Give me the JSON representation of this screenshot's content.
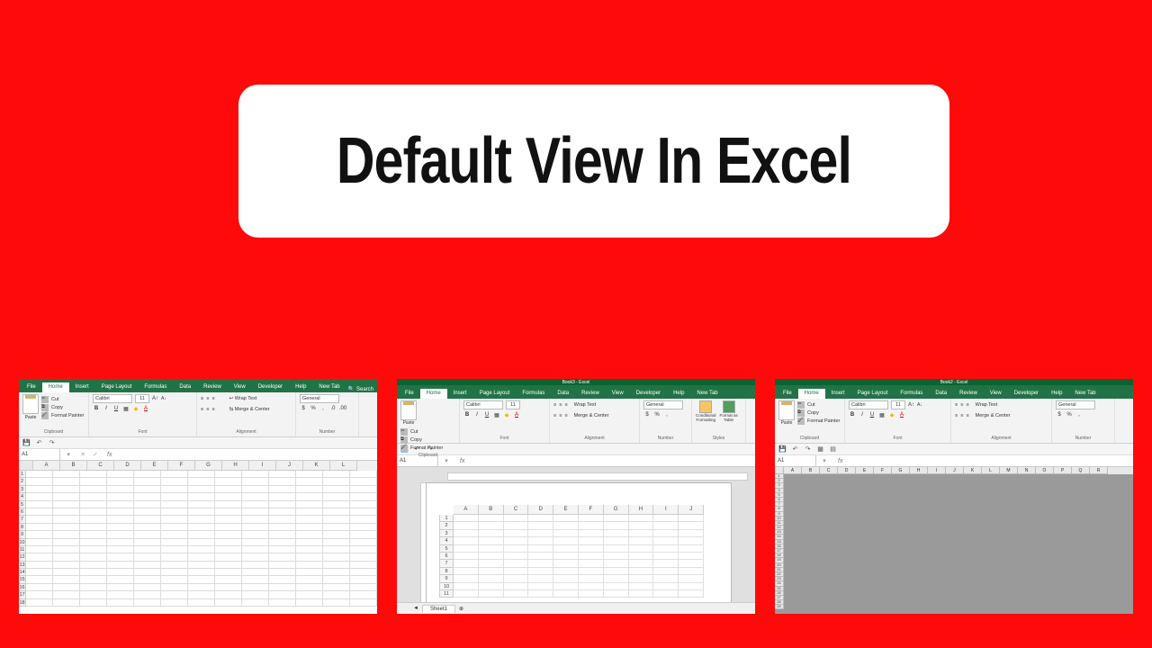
{
  "title": "Default View In Excel",
  "tabs": [
    "File",
    "Home",
    "Insert",
    "Page Layout",
    "Formulas",
    "Data",
    "Review",
    "View",
    "Developer",
    "Help",
    "New Tab"
  ],
  "search_label": "Search",
  "ribbon": {
    "clipboard": {
      "label": "Clipboard",
      "cut": "Cut",
      "copy": "Copy",
      "format_painter": "Format Painter",
      "paste": "Paste"
    },
    "font": {
      "label": "Font",
      "name": "Calibri",
      "size": "11"
    },
    "alignment": {
      "label": "Alignment",
      "wrap": "Wrap Text",
      "merge": "Merge & Center"
    },
    "number": {
      "label": "Number",
      "format": "General"
    },
    "styles": {
      "label": "Styles",
      "cond": "Conditional\nFormatting",
      "table": "Format as\nTable"
    }
  },
  "namebox": "A1",
  "fx": "fx",
  "columns": [
    "A",
    "B",
    "C",
    "D",
    "E",
    "F",
    "G",
    "H",
    "I",
    "J",
    "K",
    "L"
  ],
  "rows18": [
    "1",
    "2",
    "3",
    "4",
    "5",
    "6",
    "7",
    "8",
    "9",
    "10",
    "11",
    "12",
    "13",
    "14",
    "15",
    "16",
    "17",
    "18"
  ],
  "page_layout": {
    "title": "Book3 - Excel",
    "cols": [
      "A",
      "B",
      "C",
      "D",
      "E",
      "F",
      "G",
      "H",
      "I",
      "J"
    ],
    "rows": [
      "1",
      "2",
      "3",
      "4",
      "5",
      "6",
      "7",
      "8",
      "9",
      "10",
      "11"
    ],
    "sheet": "Sheet1"
  },
  "page_break": {
    "title": "Book2 - Excel",
    "cols": [
      "A",
      "B",
      "C",
      "D",
      "E",
      "F",
      "G",
      "H",
      "I",
      "J",
      "K",
      "L",
      "M",
      "N",
      "O",
      "P",
      "Q",
      "R"
    ],
    "rows": [
      "1",
      "2",
      "3",
      "4",
      "5",
      "6",
      "7",
      "8",
      "9",
      "10",
      "11",
      "12",
      "13",
      "14",
      "15",
      "16",
      "17",
      "18",
      "19",
      "20",
      "21",
      "22",
      "23",
      "24",
      "25",
      "26",
      "27",
      "28",
      "29"
    ]
  }
}
